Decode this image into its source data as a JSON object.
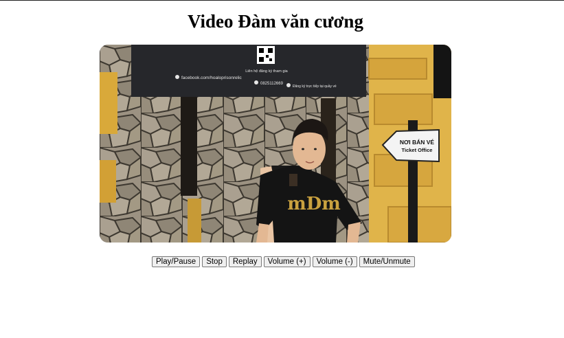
{
  "page": {
    "title": "Video Đàm văn cương"
  },
  "video": {
    "billboard": {
      "caption": "Liên hệ đăng ký tham gia",
      "facebook": "facebook.com/hoaloprisonrelic",
      "phone": "0825112669",
      "online": "Đăng ký trực tiếp tại quầy vé"
    },
    "sign": {
      "line1": "NƠI BÁN VÉ",
      "line2": "Ticket Office"
    },
    "shirt_logo": "mDm"
  },
  "controls": {
    "play_pause": "Play/Pause",
    "stop": "Stop",
    "replay": "Replay",
    "volume_up": "Volume (+)",
    "volume_down": "Volume (-)",
    "mute": "Mute/Unmute"
  }
}
